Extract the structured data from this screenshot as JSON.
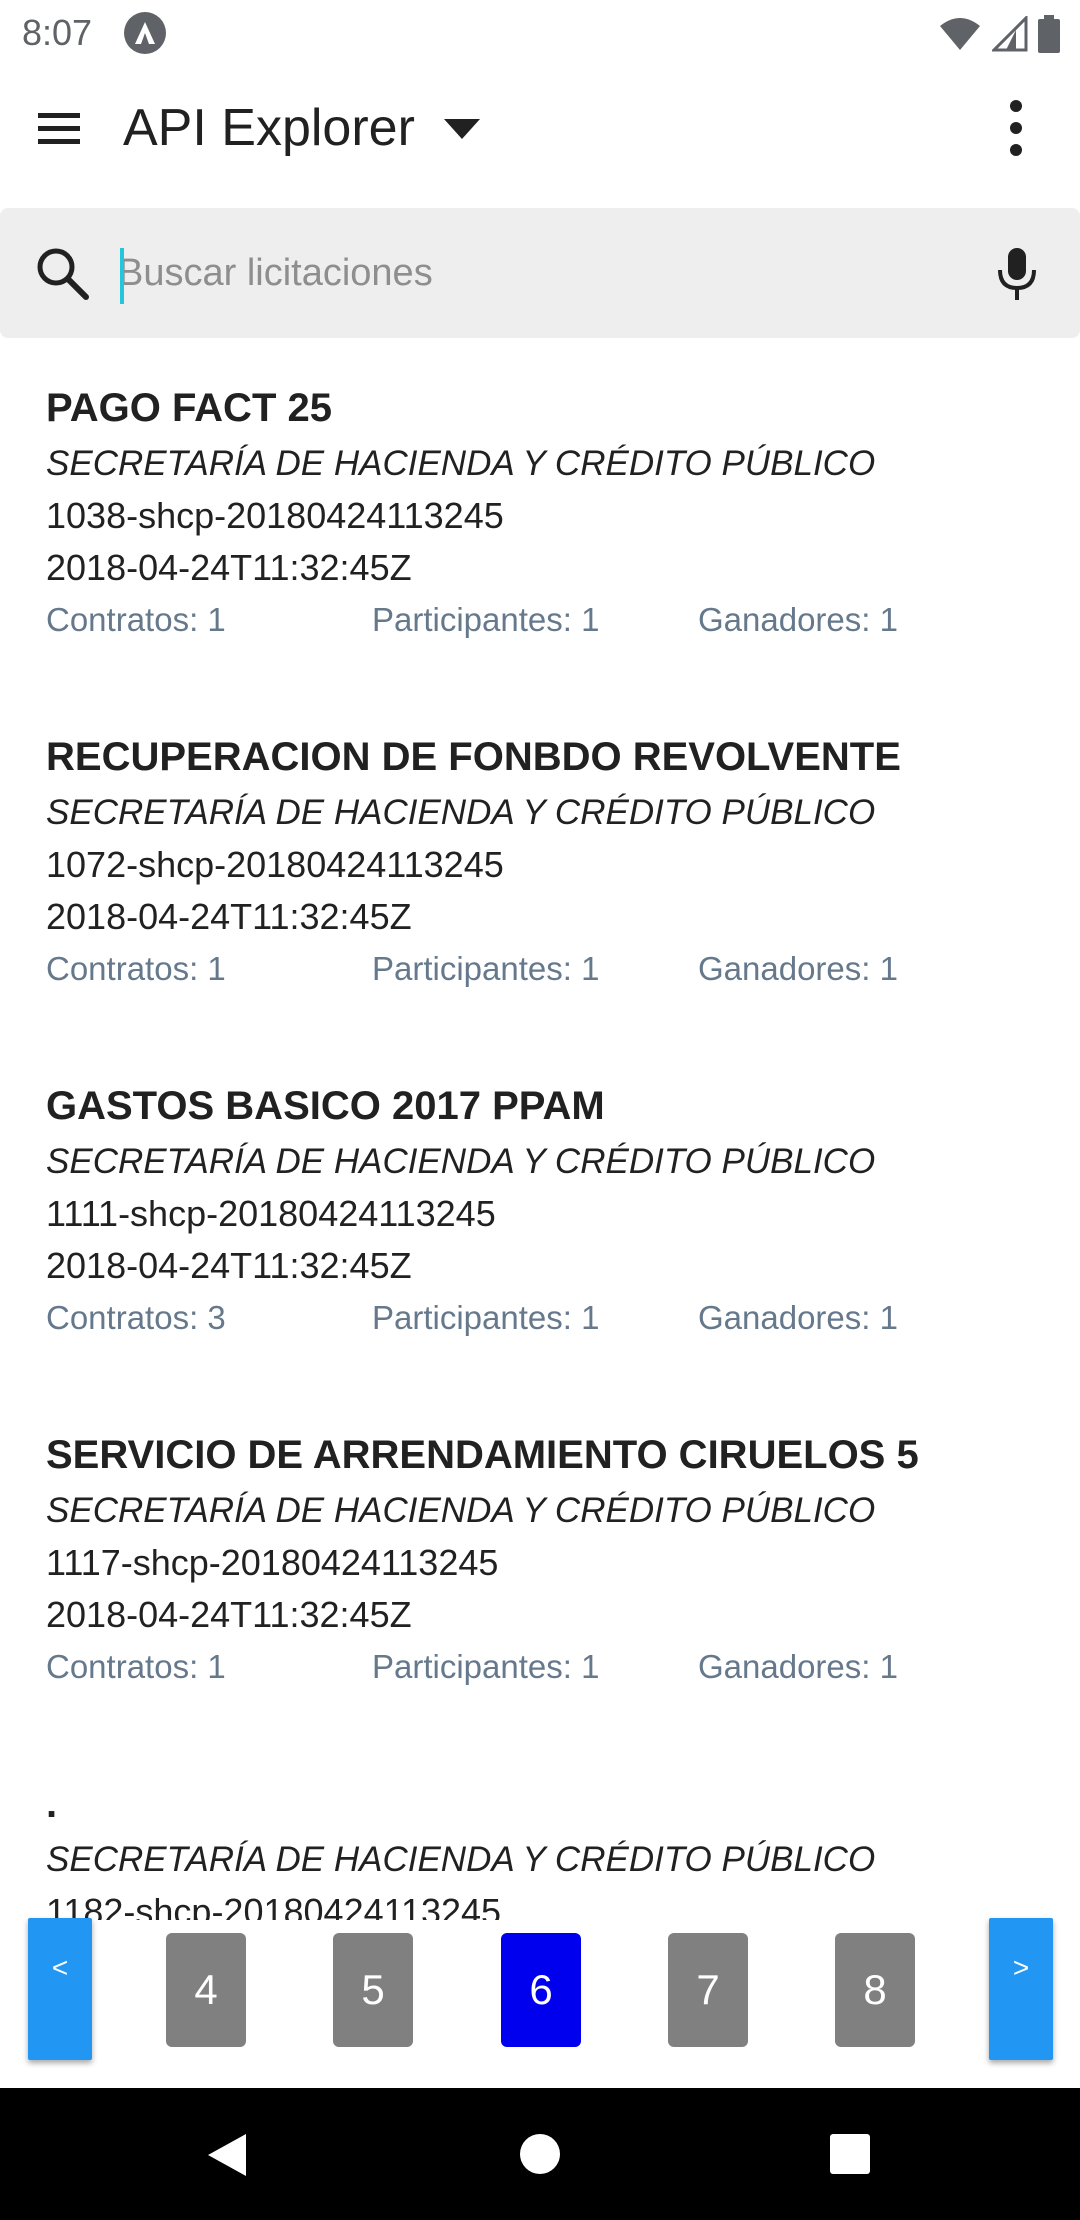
{
  "status_bar": {
    "time": "8:07"
  },
  "app_bar": {
    "title": "API Explorer"
  },
  "search": {
    "placeholder": "Buscar licitaciones",
    "value": ""
  },
  "results": [
    {
      "title": "PAGO FACT 25",
      "agency": "SECRETARÍA DE HACIENDA Y CRÉDITO PÚBLICO",
      "id": "1038-shcp-20180424113245",
      "date": "2018-04-24T11:32:45Z",
      "contracts": "Contratos: 1",
      "participants": "Participantes: 1",
      "winners": "Ganadores: 1"
    },
    {
      "title": "RECUPERACION DE FONBDO REVOLVENTE",
      "agency": "SECRETARÍA DE HACIENDA Y CRÉDITO PÚBLICO",
      "id": "1072-shcp-20180424113245",
      "date": "2018-04-24T11:32:45Z",
      "contracts": "Contratos: 1",
      "participants": "Participantes: 1",
      "winners": "Ganadores: 1"
    },
    {
      "title": "GASTOS BASICO 2017 PPAM",
      "agency": "SECRETARÍA DE HACIENDA Y CRÉDITO PÚBLICO",
      "id": "1111-shcp-20180424113245",
      "date": "2018-04-24T11:32:45Z",
      "contracts": "Contratos: 3",
      "participants": "Participantes: 1",
      "winners": "Ganadores: 1"
    },
    {
      "title": "SERVICIO DE ARRENDAMIENTO CIRUELOS 5",
      "agency": "SECRETARÍA DE HACIENDA Y CRÉDITO PÚBLICO",
      "id": "1117-shcp-20180424113245",
      "date": "2018-04-24T11:32:45Z",
      "contracts": "Contratos: 1",
      "participants": "Participantes: 1",
      "winners": "Ganadores: 1"
    },
    {
      "title": ".",
      "agency": "SECRETARÍA DE HACIENDA Y CRÉDITO PÚBLICO",
      "id": "1182-shcp-20180424113245"
    }
  ],
  "pagination": {
    "prev_label": "<",
    "next_label": ">",
    "pages": [
      "4",
      "5",
      "6",
      "7",
      "8"
    ],
    "current": "6",
    "colors": {
      "arrow": "#2196f3",
      "page": "#808080",
      "active": "#0000ee"
    }
  }
}
